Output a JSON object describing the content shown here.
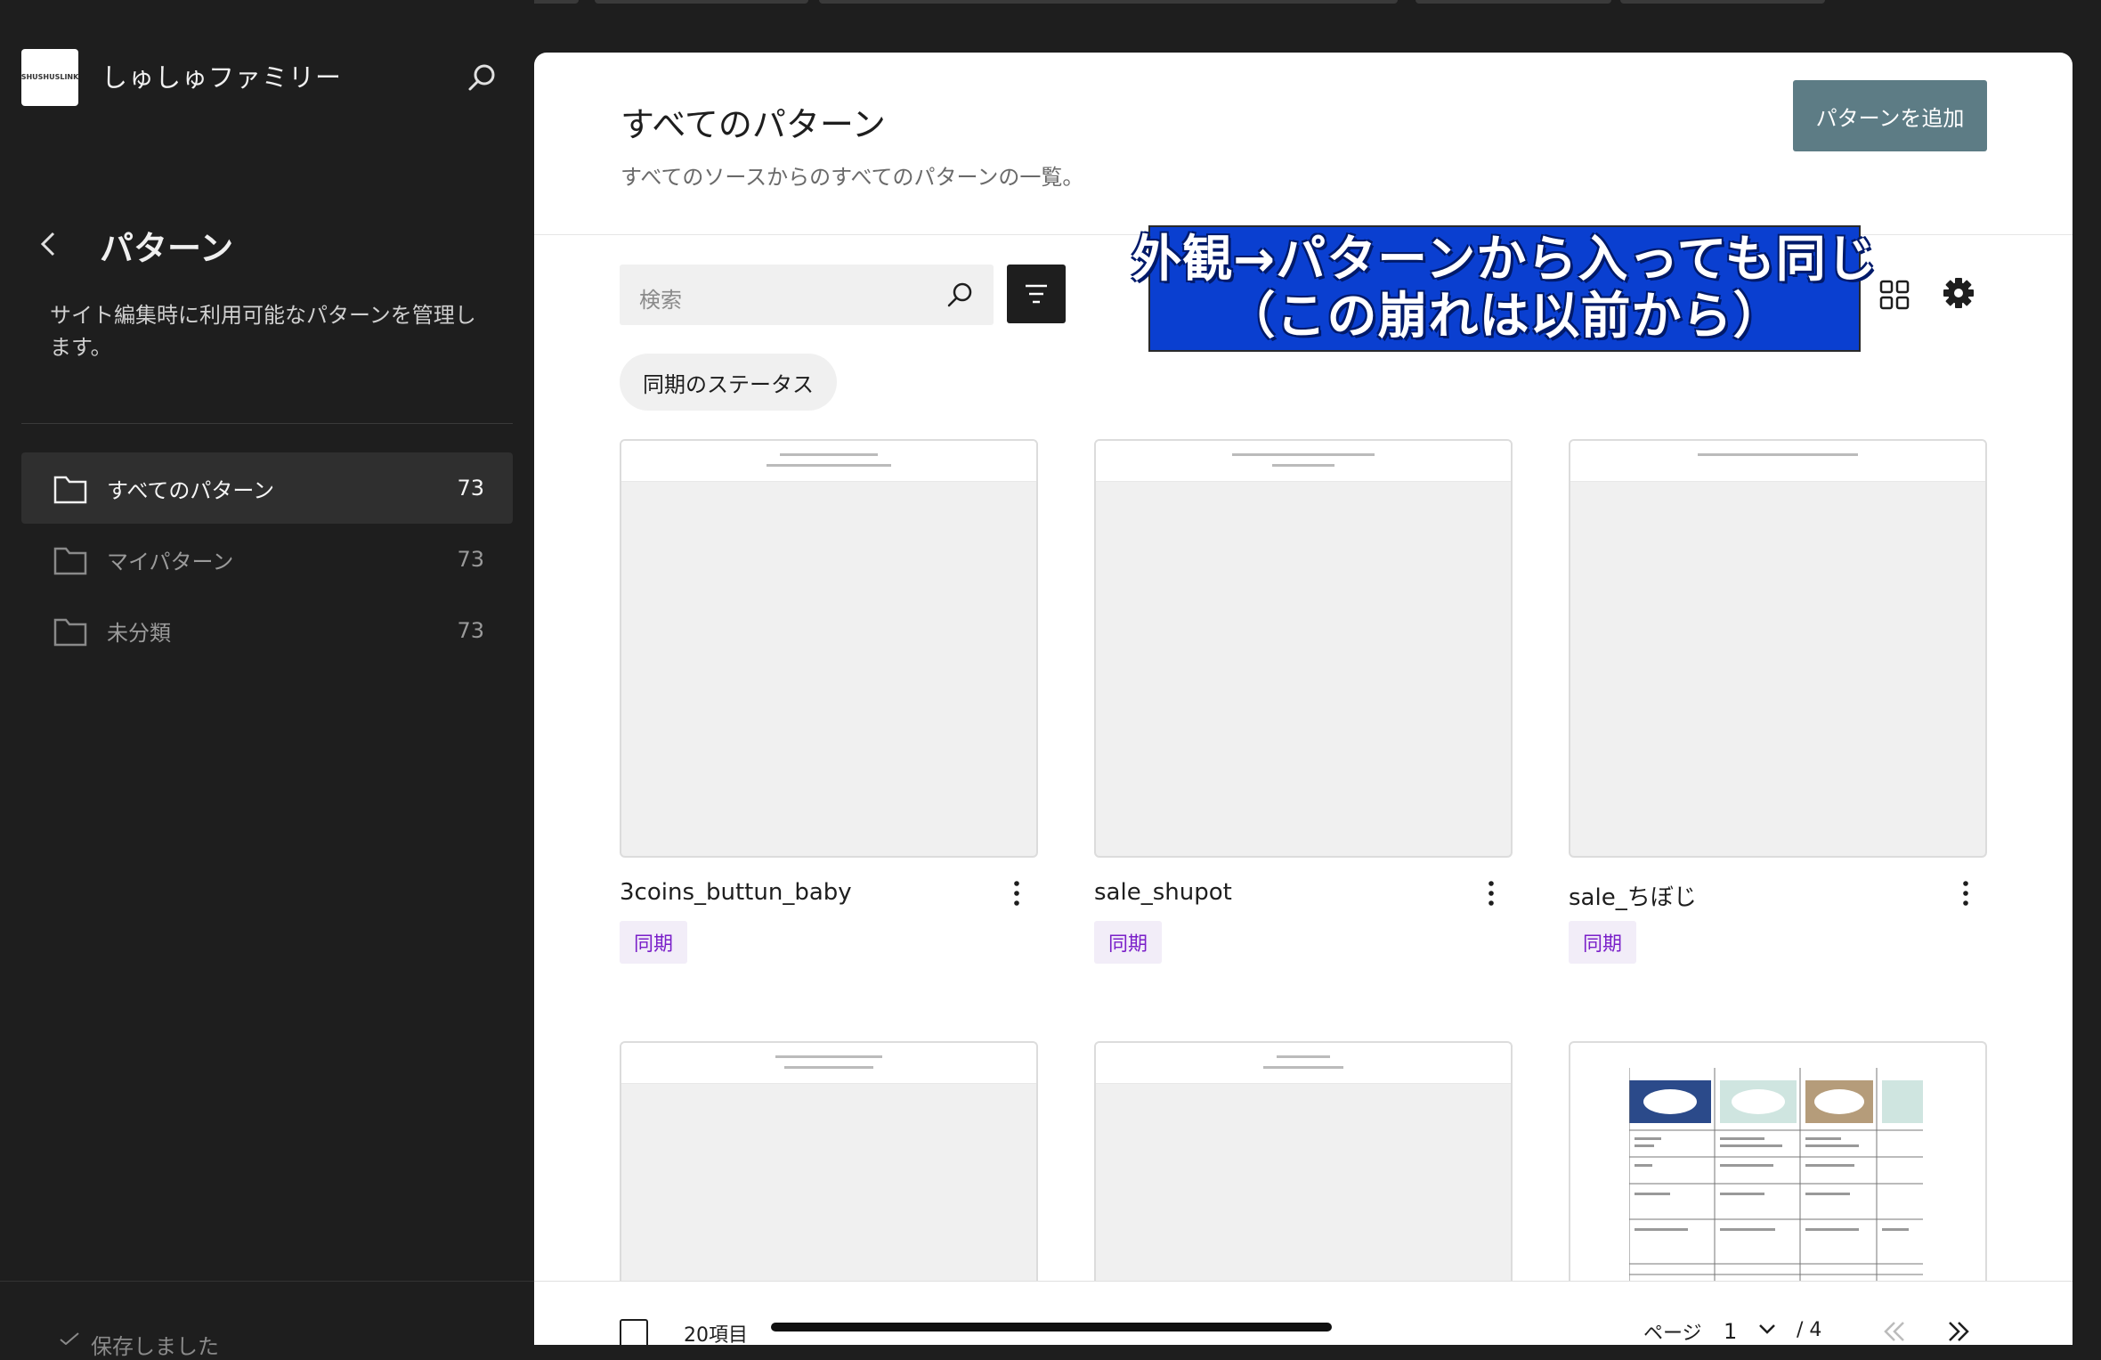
{
  "site": {
    "name": "しゅしゅファミリー",
    "logo_text": "SHUSHUSLINK"
  },
  "sidebar": {
    "title": "パターン",
    "description": "サイト編集時に利用可能なパターンを管理します。",
    "items": [
      {
        "label": "すべてのパターン",
        "count": "73",
        "active": true
      },
      {
        "label": "マイパターン",
        "count": "73",
        "active": false
      },
      {
        "label": "未分類",
        "count": "73",
        "active": false
      }
    ],
    "saved_status": "保存しました"
  },
  "main": {
    "title": "すべてのパターン",
    "description": "すべてのソースからのすべてのパターンの一覧。",
    "add_button": "パターンを追加",
    "search_placeholder": "検索",
    "sync_filter_chip": "同期のステータス",
    "annotation": {
      "line1": "外観→パターンから入っても同じ",
      "line2": "（この崩れは以前から）"
    },
    "cards": [
      {
        "title": "3coins_buttun_baby",
        "badge": "同期"
      },
      {
        "title": "sale_shupot",
        "badge": "同期"
      },
      {
        "title": "sale_ちぼじ",
        "badge": "同期"
      },
      {
        "title": "",
        "badge": ""
      },
      {
        "title": "",
        "badge": ""
      },
      {
        "title": "",
        "badge": ""
      }
    ]
  },
  "footer": {
    "item_count": "20項目",
    "page_label": "ページ",
    "current_page": "1",
    "total_pages": "/ 4"
  },
  "colors": {
    "sidebar_bg": "#1e1e1e",
    "primary_button": "#5d7c85",
    "sync_badge_text": "#7a1fc9",
    "annotation_bg": "#0a3fd0"
  }
}
